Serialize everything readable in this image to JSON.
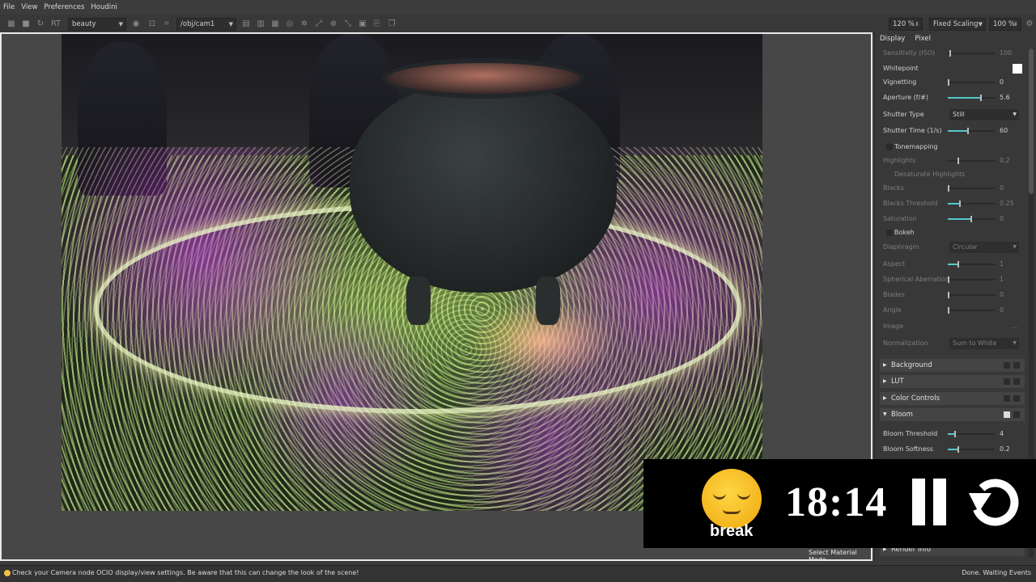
{
  "menu": [
    "File",
    "View",
    "Preferences",
    "Houdini"
  ],
  "toolbar": {
    "rt_label": "RT",
    "aov": "beauty",
    "camera_path": "/obj/cam1",
    "zoom": "120 %",
    "scaling": "Fixed Scaling",
    "scale_pct": "100 %"
  },
  "viewport": {
    "mode_label": "Select Material Mode"
  },
  "panel": {
    "tabs": [
      "Display",
      "Pixel"
    ],
    "rows": {
      "sensitivity": {
        "label": "Sensitivity (ISO)",
        "value": "100"
      },
      "whitepoint": {
        "label": "Whitepoint"
      },
      "vignetting": {
        "label": "Vignetting",
        "value": "0"
      },
      "aperture": {
        "label": "Aperture (f/#)",
        "value": "5.6"
      },
      "shutter_type": {
        "label": "Shutter Type",
        "value": "Still"
      },
      "shutter_time": {
        "label": "Shutter Time (1/s)",
        "value": "60"
      },
      "tonemapping": {
        "label": "Tonemapping"
      },
      "highlights": {
        "label": "Highlights",
        "value": "0.2"
      },
      "desaturate": {
        "label": "Desaturate Highlights"
      },
      "blacks": {
        "label": "Blacks",
        "value": "0"
      },
      "blacks_threshold": {
        "label": "Blacks Threshold",
        "value": "0.25"
      },
      "saturation": {
        "label": "Saturation",
        "value": "0"
      },
      "bokeh": {
        "label": "Bokeh"
      },
      "diaphragm": {
        "label": "Diaphragm",
        "value": "Circular"
      },
      "aspect": {
        "label": "Aspect",
        "value": "1"
      },
      "spherical": {
        "label": "Spherical Aberration",
        "value": "1"
      },
      "blades": {
        "label": "Blades",
        "value": "0"
      },
      "angle": {
        "label": "Angle",
        "value": "0"
      },
      "image": {
        "label": "Image",
        "value": "..."
      },
      "normalization": {
        "label": "Normalization",
        "value": "Sum to White"
      },
      "bloom_threshold": {
        "label": "Bloom Threshold",
        "value": "4"
      },
      "bloom_softness": {
        "label": "Bloom Softness",
        "value": "0.2"
      }
    },
    "sections": {
      "background": "Background",
      "lut": "LUT",
      "color_controls": "Color Controls",
      "bloom": "Bloom",
      "render_info": "Render Info"
    }
  },
  "status": {
    "message": "Check your Camera node OCIO display/view settings. Be aware that this can change the look of the scene!",
    "right": "Done. Waiting Events"
  },
  "overlay": {
    "label": "break",
    "time": "18:14"
  }
}
